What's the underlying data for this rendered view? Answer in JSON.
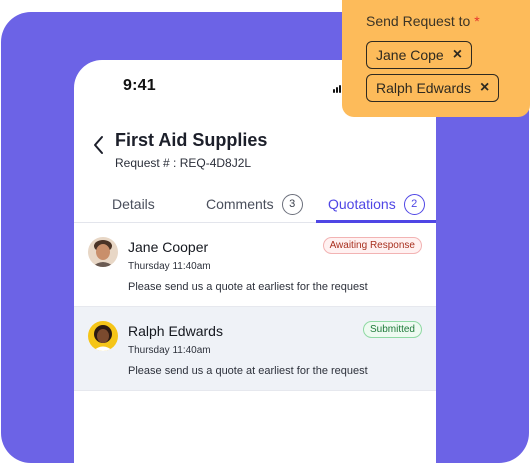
{
  "status_bar": {
    "time": "9:41"
  },
  "header": {
    "title": "First Aid Supplies",
    "request_number": "Request # : REQ-4D8J2L"
  },
  "tabs": [
    {
      "label": "Details"
    },
    {
      "label": "Comments",
      "count": "3"
    },
    {
      "label": "Quotations",
      "count": "2"
    }
  ],
  "active_tab": "Quotations",
  "quotations": [
    {
      "name": "Jane Cooper",
      "time": "Thursday 11:40am",
      "message": "Please send us a quote at earliest for the request",
      "status": "Awaiting Response",
      "status_color": "#a8301f"
    },
    {
      "name": "Ralph Edwards",
      "time": "Thursday 11:40am",
      "message": "Please send us a quote at earliest for the request",
      "status": "Submitted",
      "status_color": "#1f7a3a"
    }
  ],
  "send_request": {
    "label": "Send Request to",
    "required_marker": "*",
    "recipients": [
      {
        "name": "Jane Cope"
      },
      {
        "name": "Ralph Edwards"
      }
    ],
    "remove_icon": "close-icon"
  },
  "colors": {
    "accent": "#4f46e5",
    "backdrop": "#6c63e6",
    "popup": "#fdbb5a"
  }
}
